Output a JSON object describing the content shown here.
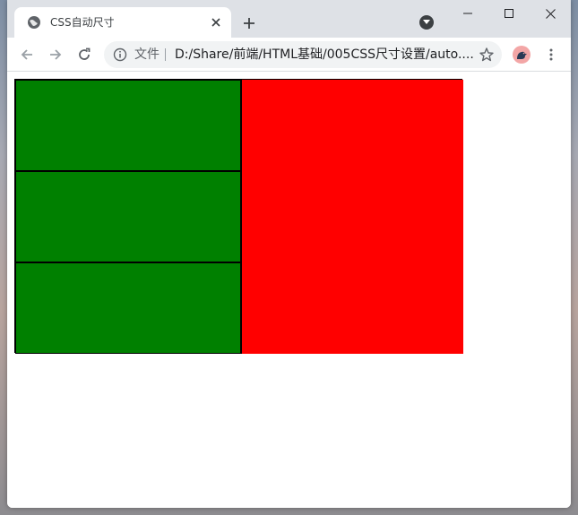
{
  "tab": {
    "title": "CSS自动尺寸",
    "favicon": "globe-icon"
  },
  "toolbar": {
    "scheme_label": "文件",
    "url": "D:/Share/前端/HTML基础/005CSS尺寸设置/auto...."
  },
  "icons": {
    "close": "close-icon",
    "new_tab": "plus-icon",
    "tab_search": "chevron-down-icon",
    "minimize": "minimize-icon",
    "maximize": "maximize-icon",
    "window_close": "close-icon",
    "back": "back-arrow-icon",
    "forward": "forward-arrow-icon",
    "reload": "reload-icon",
    "info": "info-icon",
    "star": "star-icon",
    "profile": "avatar-icon",
    "menu": "kebab-menu-icon"
  },
  "colors": {
    "green_box": "#008000",
    "red_box": "#ff0000",
    "border": "#000000"
  }
}
